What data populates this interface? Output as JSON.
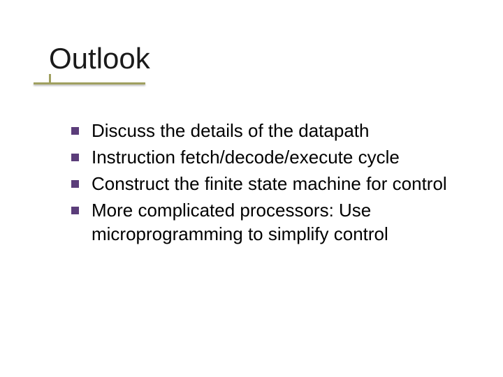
{
  "title": "Outlook",
  "bullets": [
    "Discuss the details of the datapath",
    "Instruction fetch/decode/execute cycle",
    "Construct the finite state machine for control",
    "More complicated processors: Use microprogramming to simplify control"
  ]
}
